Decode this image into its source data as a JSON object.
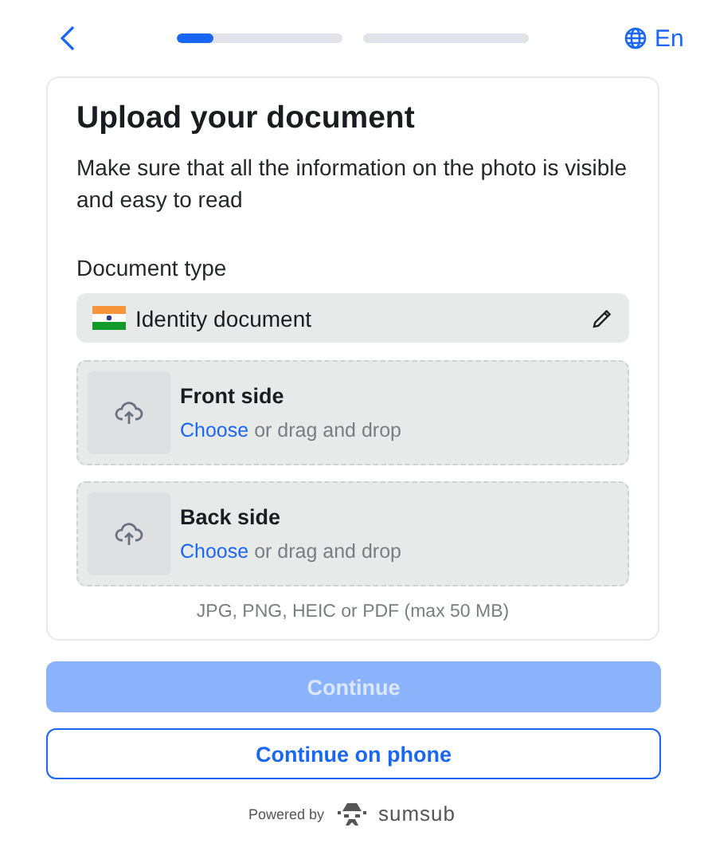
{
  "header": {
    "steps": [
      {
        "level": 0.22
      },
      {
        "level": 0
      }
    ],
    "language": "En"
  },
  "card": {
    "title": "Upload your document",
    "description": "Make sure that all the information on the photo is visible and easy to read",
    "document_type": {
      "label": "Document type",
      "value": "Identity document"
    },
    "uploads": [
      {
        "title": "Front side",
        "link": "Choose",
        "hint": "or drag and drop"
      },
      {
        "title": "Back side",
        "link": "Choose",
        "hint": "or drag and drop"
      }
    ],
    "formats": "JPG, PNG, HEIC or PDF (max 50 MB)"
  },
  "buttons": [
    {
      "label": "Continue",
      "kind": "primary",
      "disabled": true
    },
    {
      "label": "Continue on phone",
      "kind": "outline",
      "disabled": false
    }
  ],
  "footer": {
    "powered_by": "Powered by",
    "brand": "sumsub"
  }
}
